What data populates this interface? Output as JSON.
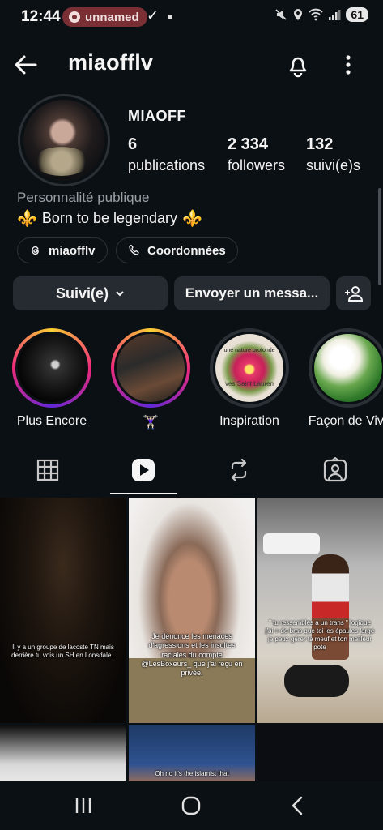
{
  "status_bar": {
    "time": "12:44",
    "pill": "unnamed",
    "battery": "61"
  },
  "header": {
    "username": "miaofflv"
  },
  "profile": {
    "display_name": "MIAOFF",
    "stats": [
      {
        "num": "6",
        "label": "publications"
      },
      {
        "num": "2 334",
        "label": "followers"
      },
      {
        "num": "132",
        "label": "suivi(e)s"
      }
    ],
    "category": "Personnalité publique",
    "bio_fleur": "⚜️",
    "bio": "Born to be legendary",
    "threads_handle": "miaofflv",
    "contact_label": "Coordonnées"
  },
  "actions": {
    "following_label": "Suivi(e)",
    "message_label": "Envoyer un messa..."
  },
  "highlights": [
    {
      "label": "Plus Encore",
      "style": "gradient"
    },
    {
      "label": "🏋🏻‍♀️",
      "style": "gradient"
    },
    {
      "label": "Inspiration",
      "style": "plain"
    },
    {
      "label": "Façon de Vivr",
      "style": "plain"
    }
  ],
  "highlight_texts": {
    "inspiration_top": "une nature profonde",
    "inspiration_bottom": "ves Saint Lauren"
  },
  "grid": {
    "post1_caption": "Il y a un groupe de lacoste TN mais derrière tu vois un SH en Lonsdale..",
    "post2_caption": "Je dénonce les menaces d'agressions et les insultes raciales du compte @LesBoxeurs_ que j'ai reçu en privée.",
    "post3_caption": "\" tu ressembles a un trans \" logique j'ai + de bras que toi les épaules large je peux gérer ta meuf et ton meilleur pote",
    "post5_caption": "Oh no it's the islamist that"
  },
  "colors": {
    "background": "#0b1014",
    "button": "#262b31",
    "pill": "#7a2f35",
    "fleur": "#e6b824"
  },
  "icons": [
    "back-arrow-icon",
    "bell-icon",
    "more-vertical-icon",
    "threads-icon",
    "phone-icon",
    "chevron-down-icon",
    "add-person-icon",
    "grid-icon",
    "reels-icon",
    "reposts-icon",
    "tagged-icon"
  ]
}
